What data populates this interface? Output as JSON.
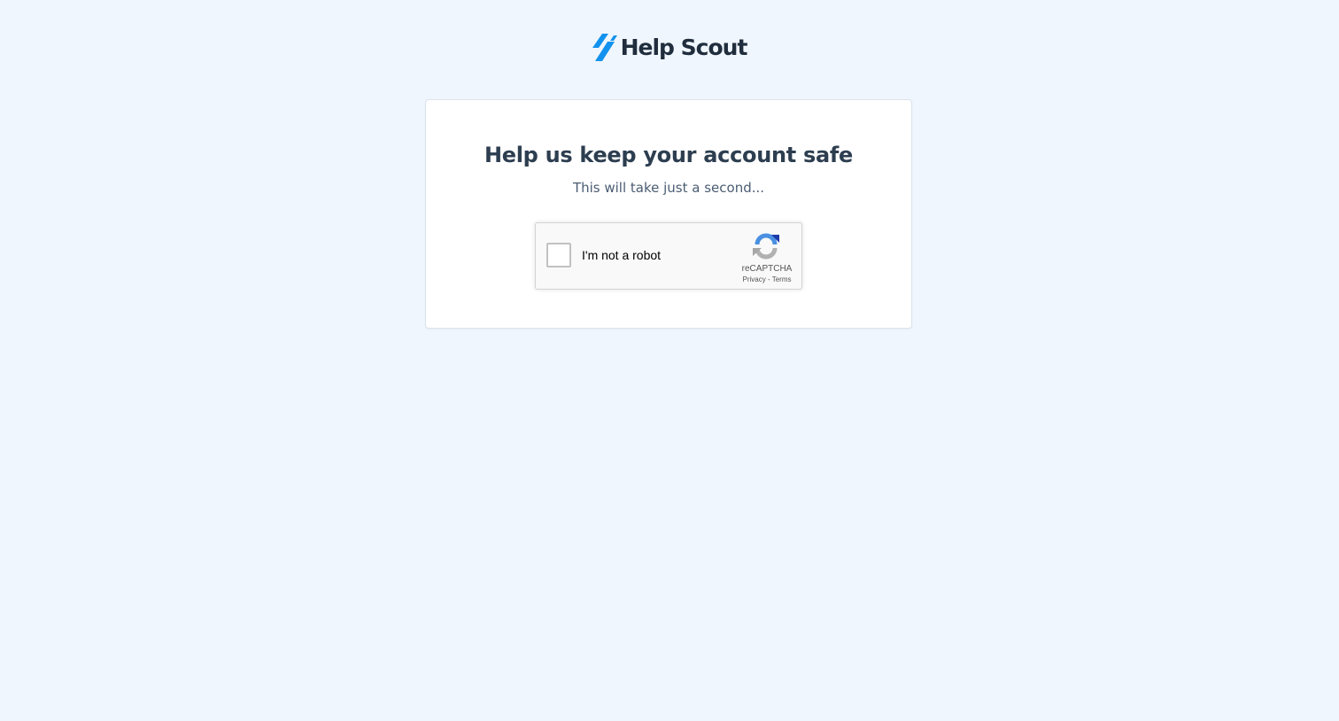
{
  "brand": {
    "name": "Help Scout",
    "accent_color": "#1292ee",
    "text_color": "#1f2d3d"
  },
  "card": {
    "heading": "Help us keep your account safe",
    "subheading": "This will take just a second..."
  },
  "captcha": {
    "checkbox_label": "I'm not a robot",
    "checked": false,
    "brand": "reCAPTCHA",
    "privacy_link": "Privacy",
    "separator": "-",
    "terms_link": "Terms"
  }
}
